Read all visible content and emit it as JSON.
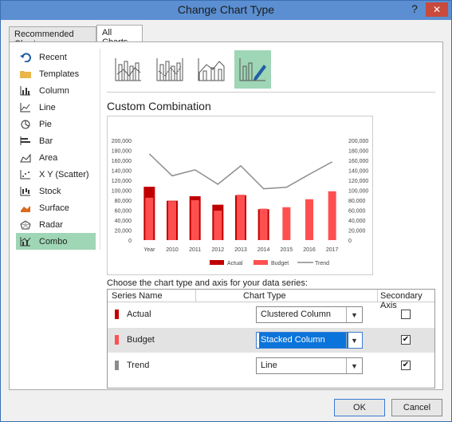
{
  "window": {
    "title": "Change Chart Type",
    "help": "?",
    "close": "✕"
  },
  "tabs": [
    "Recommended Charts",
    "All Charts"
  ],
  "sidebar": {
    "items": [
      {
        "label": "Recent",
        "icon": "recent-icon"
      },
      {
        "label": "Templates",
        "icon": "folder-icon"
      },
      {
        "label": "Column",
        "icon": "column-chart-icon"
      },
      {
        "label": "Line",
        "icon": "line-chart-icon"
      },
      {
        "label": "Pie",
        "icon": "pie-chart-icon"
      },
      {
        "label": "Bar",
        "icon": "bar-chart-icon"
      },
      {
        "label": "Area",
        "icon": "area-chart-icon"
      },
      {
        "label": "X Y (Scatter)",
        "icon": "scatter-chart-icon"
      },
      {
        "label": "Stock",
        "icon": "stock-chart-icon"
      },
      {
        "label": "Surface",
        "icon": "surface-chart-icon"
      },
      {
        "label": "Radar",
        "icon": "radar-chart-icon"
      },
      {
        "label": "Combo",
        "icon": "combo-chart-icon"
      }
    ],
    "selected": "Combo"
  },
  "main": {
    "section_title": "Custom Combination",
    "series_prompt": "Choose the chart type and axis for your data series:"
  },
  "series_table": {
    "headers": {
      "name": "Series Name",
      "type": "Chart Type",
      "axis": "Secondary Axis"
    },
    "rows": [
      {
        "name": "Actual",
        "color": "#c00000",
        "type": "Clustered Column",
        "secondary": false
      },
      {
        "name": "Budget",
        "color": "#ff5050",
        "type": "Stacked Column",
        "secondary": true
      },
      {
        "name": "Trend",
        "color": "#8c8c8c",
        "type": "Line",
        "secondary": true
      }
    ]
  },
  "buttons": {
    "ok": "OK",
    "cancel": "Cancel"
  },
  "chart_data": {
    "type": "bar",
    "categories": [
      "Year",
      "2010",
      "2011",
      "2012",
      "2013",
      "2014",
      "2015",
      "2016",
      "2017"
    ],
    "y_ticks": [
      "200,000",
      "180,000",
      "160,000",
      "140,000",
      "120,000",
      "100,000",
      "80,000",
      "60,000",
      "40,000",
      "20,000",
      "0"
    ],
    "ylim": [
      0,
      200000
    ],
    "series": [
      {
        "name": "Actual",
        "kind": "column",
        "color": "#c00000",
        "values": [
          107000,
          79000,
          88000,
          71000,
          90000,
          62000,
          null,
          null,
          null
        ]
      },
      {
        "name": "Budget",
        "kind": "column",
        "color": "#ff5050",
        "values": [
          85000,
          78000,
          80000,
          59000,
          91000,
          63000,
          66000,
          82000,
          98000
        ]
      },
      {
        "name": "Trend",
        "kind": "line",
        "color": "#8c8c8c",
        "values": [
          173000,
          129000,
          141000,
          112000,
          149000,
          103000,
          106000,
          132000,
          157000
        ]
      }
    ],
    "legend": [
      "Actual",
      "Budget",
      "Trend"
    ],
    "legend_position": "bottom"
  }
}
